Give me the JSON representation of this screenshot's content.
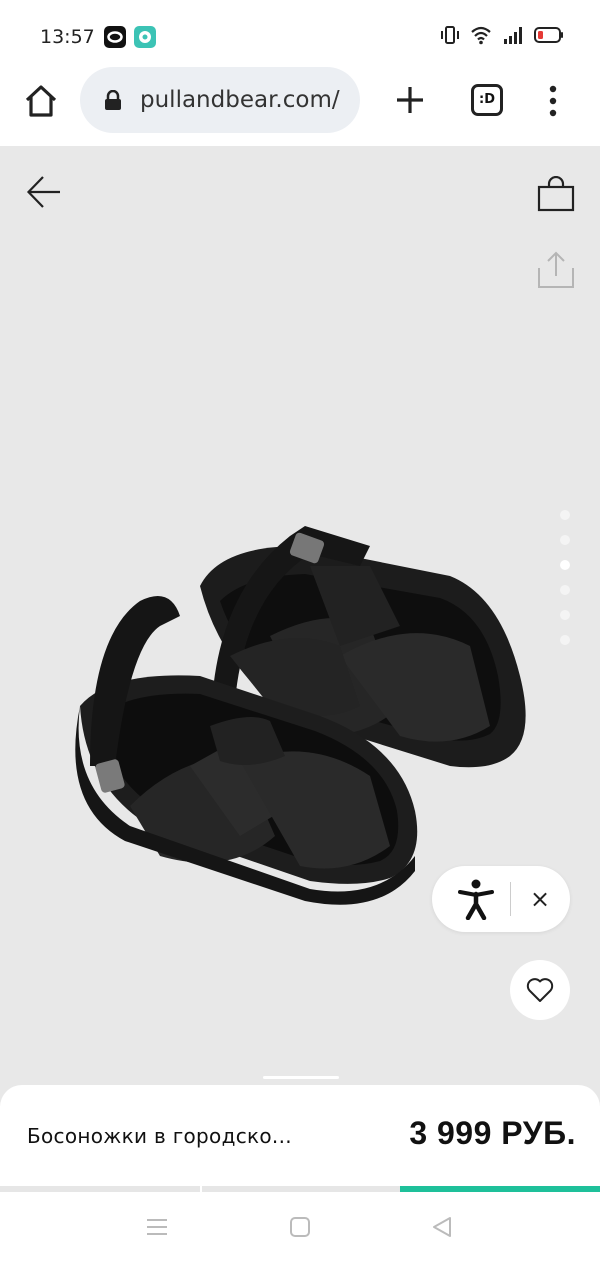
{
  "status": {
    "time": "13:57",
    "battery_color": "#e53935"
  },
  "browser": {
    "url": "pullandbear.com/",
    "tabs_label": ":D"
  },
  "product": {
    "name": "Босоножки в городско...",
    "price": "3 999 РУБ.",
    "image_index": 3,
    "image_count": 6
  },
  "accessibility": {
    "close_label": "×"
  },
  "colors": {
    "product_bg": "#e8e8e8",
    "progress_active": "#1ec09a"
  },
  "icons": [
    "home-icon",
    "lock-icon",
    "plus-icon",
    "tabs-icon",
    "more-vert-icon",
    "back-arrow-icon",
    "bag-icon",
    "share-icon",
    "accessibility-icon",
    "close-icon",
    "heart-icon",
    "recent-apps-icon",
    "home-square-icon",
    "back-triangle-icon"
  ]
}
